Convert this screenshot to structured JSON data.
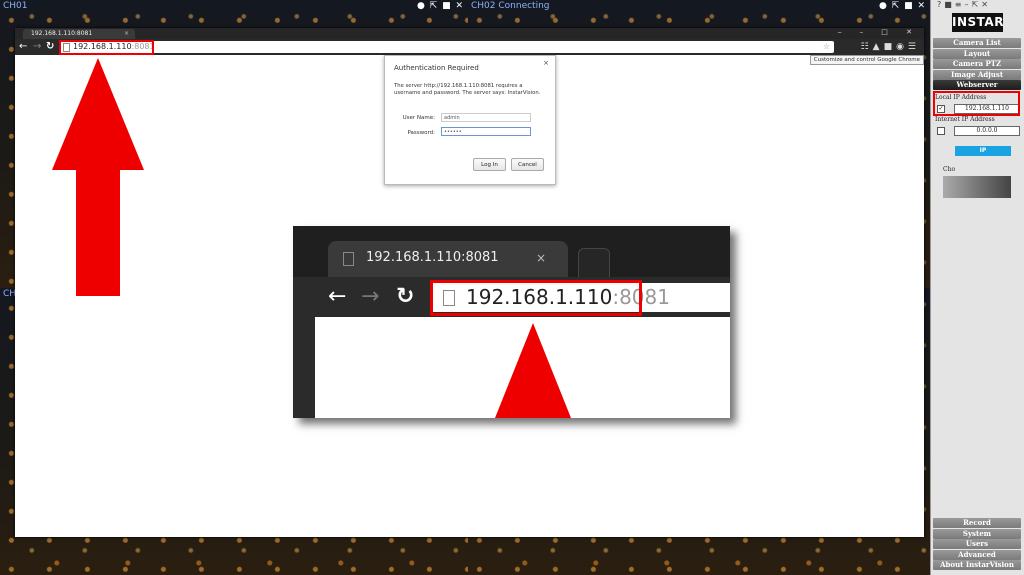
{
  "cameras": {
    "ch01": "CH01",
    "ch02": "CH02 Connecting",
    "ch03": "CH"
  },
  "browser": {
    "tab_title": "192.168.1.110:8081",
    "url_host": "192.168.1.110",
    "url_port": ":8081",
    "tooltip": "Customize and control Google Chrome"
  },
  "auth": {
    "title": "Authentication Required",
    "message": "The server http://192.168.1.110:8081 requires a username and password. The server says: InstarVision.",
    "username_label": "User Name:",
    "username_value": "admin",
    "password_label": "Password:",
    "password_value": "••••••",
    "login_label": "Log In",
    "cancel_label": "Cancel"
  },
  "zoom": {
    "tab_title": "192.168.1.110:8081",
    "url_host": "192.168.1.110",
    "url_port": ":8081"
  },
  "sidebar": {
    "logo": "INSTAR",
    "top_menu": [
      "Camera List",
      "Layout",
      "Camera PTZ",
      "Image Adjust",
      "Webserver"
    ],
    "active_item": "Webserver",
    "local_ip_label": "Local IP Address",
    "local_ip_value": "192.168.1.110",
    "internet_ip_label": "Internet IP Address",
    "internet_ip_value": "0.0.0.0",
    "blue_button": "IP",
    "choose_label": "Cho",
    "bottom_menu": [
      "Record",
      "System",
      "Users",
      "Advanced",
      "About InstarVision"
    ]
  },
  "colors": {
    "highlight": "#e00000",
    "arrow": "#ee0000",
    "sidebar_active": "#1c1c1c",
    "sidebar_button": "#8a8a8a",
    "accent_blue": "#19a3e3"
  }
}
